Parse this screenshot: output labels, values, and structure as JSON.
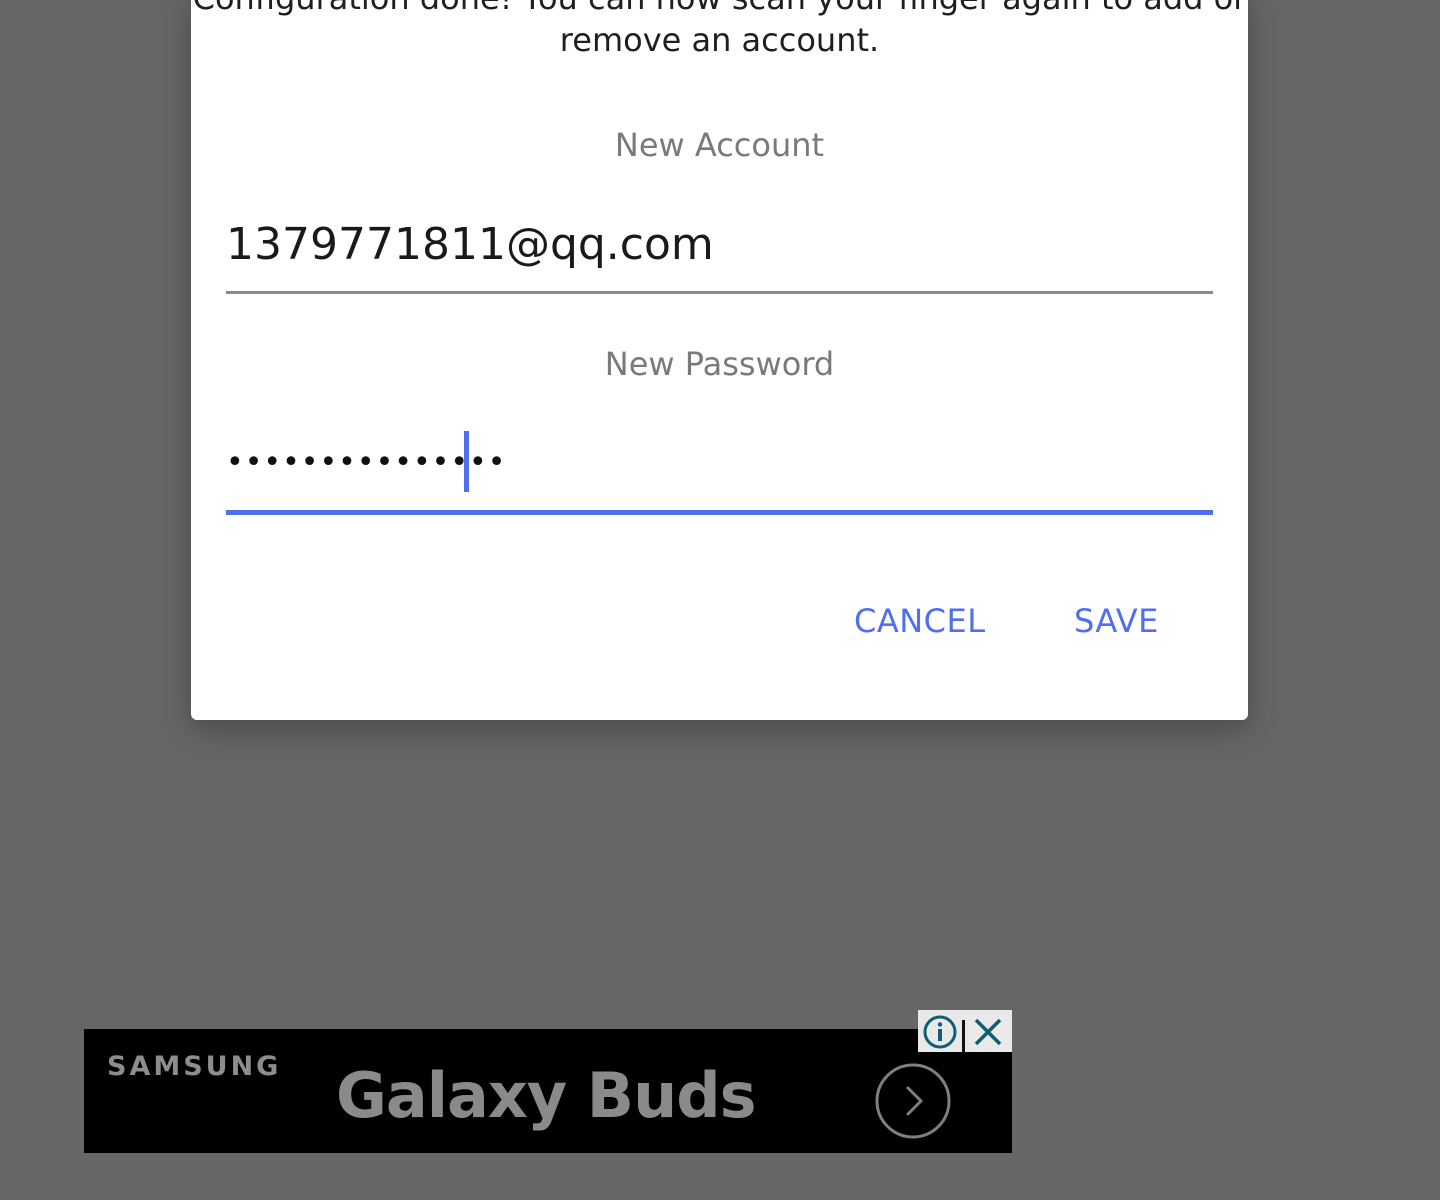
{
  "dialog": {
    "message_line1": "Configuration done! You can now scan your finger again to add or",
    "message_line2": "remove an account.",
    "account_label": "New Account",
    "account_value": "1379771811@qq.com",
    "password_label": "New Password",
    "password_value": "•••••••••••••••",
    "cancel_label": "CANCEL",
    "save_label": "SAVE",
    "accent_color": "#4f6ef2"
  },
  "ad": {
    "brand": "SAMSUNG",
    "product": "Galaxy Buds",
    "icons": [
      "info-icon",
      "close-icon",
      "chevron-right-icon"
    ]
  }
}
